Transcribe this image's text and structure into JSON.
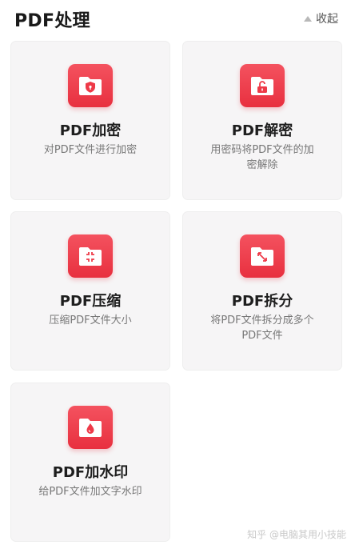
{
  "header": {
    "title": "PDF处理",
    "collapse_label": "收起"
  },
  "cards": [
    {
      "title": "PDF加密",
      "desc": "对PDF文件进行加密",
      "icon": "folder-shield-icon"
    },
    {
      "title": "PDF解密",
      "desc": "用密码将PDF文件的加密解除",
      "icon": "folder-unlock-icon"
    },
    {
      "title": "PDF压缩",
      "desc": "压缩PDF文件大小",
      "icon": "folder-compress-icon"
    },
    {
      "title": "PDF拆分",
      "desc": "将PDF文件拆分成多个PDF文件",
      "icon": "folder-split-icon"
    },
    {
      "title": "PDF加水印",
      "desc": "给PDF文件加文字水印",
      "icon": "folder-watermark-icon"
    }
  ],
  "watermark": "知乎 @电脑其用小技能",
  "colors": {
    "accent": "#ee3a48",
    "card_bg": "#f6f5f6",
    "title_text": "#1e1e1e",
    "desc_text": "#777777"
  }
}
